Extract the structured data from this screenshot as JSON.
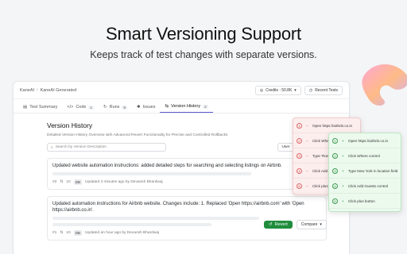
{
  "hero": {
    "title": "Smart Versioning Support",
    "subtitle": "Keeps track of test changes with separate versions."
  },
  "topbar": {
    "crumbs": [
      "KaneAI",
      "KaneAI Generated"
    ],
    "credits_label": "Credits : 50.8K",
    "recent_tests_label": "Recent Tests"
  },
  "tabs": [
    {
      "label": "Test Summary",
      "count": ""
    },
    {
      "label": "Code",
      "count": "1"
    },
    {
      "label": "Runs",
      "count": "8"
    },
    {
      "label": "Issues",
      "count": ""
    },
    {
      "label": "Version History",
      "count": "2"
    }
  ],
  "version_history": {
    "title": "Version History",
    "subtitle": "Detailed Version History Overview with Advanced Revert Functionality for Precise and Controlled Rollbacks",
    "search_placeholder": "Search by Version Description",
    "user_filter": "User"
  },
  "versions": [
    {
      "title": "Updated website automation instructions: added detailed steps for searching and selecting listings on Airbnb.",
      "version": "#2",
      "steps": "10",
      "avatar": "DB",
      "updated": "Updated 3 minutes ago by Devansh Bhardwaj"
    },
    {
      "title": "Updated automation instructions for Airbnb website. Changes include: 1. Replaced 'Open https://airbnb.com' with 'Open https://airbnb.co.in'.",
      "version": "#1",
      "steps": "10",
      "avatar": "DB",
      "updated": "Updated an hour ago by Devansh Bhardwaj",
      "revert_label": "Revert",
      "compare_label": "Compare"
    }
  ],
  "diff_removed": [
    {
      "n": "1",
      "text": "Open https://airbnb.co.in"
    },
    {
      "n": "2",
      "text": "Click Where"
    },
    {
      "n": "3",
      "text": "Type 'Rome'"
    },
    {
      "n": "4",
      "text": "Click Add G"
    },
    {
      "n": "5",
      "text": "Click plus"
    }
  ],
  "diff_added": [
    {
      "n": "1",
      "text": "Open https://airbnb.co.in"
    },
    {
      "n": "2",
      "text": "Click Where control"
    },
    {
      "n": "3",
      "text": "Type New York in location field"
    },
    {
      "n": "4",
      "text": "Click Add Guests control"
    },
    {
      "n": "5",
      "text": "Click plus button"
    }
  ],
  "colors": {
    "accent": "#5b5bd6",
    "revert_green": "#1f8d3d",
    "removed_bg": "#fdeeee",
    "added_bg": "#ecfaee"
  }
}
